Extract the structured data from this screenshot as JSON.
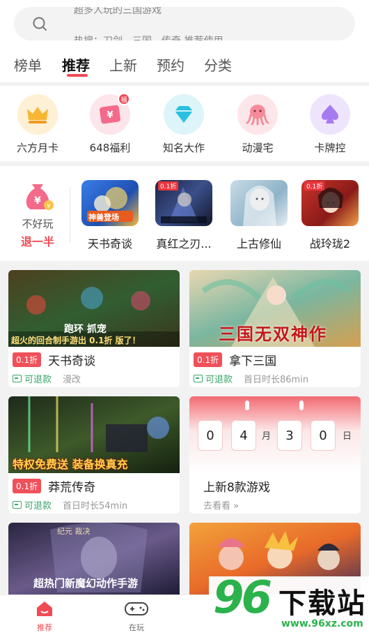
{
  "search": {
    "line1": "超多人玩的三国游戏",
    "line2": "热搜：刀剑、三国、传奇 推荐使用"
  },
  "tabs": [
    {
      "label": "榜单",
      "active": false
    },
    {
      "label": "推荐",
      "active": true
    },
    {
      "label": "上新",
      "active": false
    },
    {
      "label": "预约",
      "active": false
    },
    {
      "label": "分类",
      "active": false
    }
  ],
  "categories": [
    {
      "label": "六方月卡",
      "icon": "crown-icon",
      "color": "#f7b733"
    },
    {
      "label": "648福利",
      "icon": "ticket-icon",
      "color": "#f46a8a",
      "badge": "福"
    },
    {
      "label": "知名大作",
      "icon": "diamond-icon",
      "color": "#29c0e0"
    },
    {
      "label": "动漫宅",
      "icon": "octopus-icon",
      "color": "#f58a9a"
    },
    {
      "label": "卡牌控",
      "icon": "spade-icon",
      "color": "#a77bf0"
    }
  ],
  "refund_promo": {
    "line1": "不好玩",
    "line2": "退一半"
  },
  "featured_games": [
    {
      "name": "天书奇谈",
      "img_label": "神兽登场",
      "bg": "#2c6bd8"
    },
    {
      "name": "真红之刃...",
      "img_label": "0.1折",
      "bg": "#1f2a4a"
    },
    {
      "name": "上古修仙",
      "img_label": "",
      "bg": "#a7c6d8"
    },
    {
      "name": "战玲珑2",
      "img_label": "0.1折",
      "bg": "#c8352a"
    }
  ],
  "cards": [
    {
      "discount": "0.1折",
      "title": "天书奇谈",
      "refundable": "可退款",
      "meta": "漫改",
      "banner": "超火的回合制手游出 0.1折 版了！",
      "banner2": "跑环  抓宠"
    },
    {
      "discount": "0.1折",
      "title": "拿下三国",
      "refundable": "可退款",
      "meta": "首日时长86min",
      "banner": "三国无双神作"
    },
    {
      "discount": "0.1折",
      "title": "莽荒传奇",
      "refundable": "可退款",
      "meta": "首日时长54min",
      "banner": "特权免费送 装备换真充"
    },
    {
      "title": "上新8款游戏",
      "more": "去看看 »",
      "countdown": {
        "d1": "0",
        "d2": "4",
        "unit1": "月",
        "d3": "3",
        "d4": "0",
        "unit2": "日"
      }
    },
    {
      "banner": "超热门新魔幻动作手游",
      "banner_top": "纪元  裁决"
    },
    {
      "banner": ""
    }
  ],
  "bottom_nav": [
    {
      "label": "推荐",
      "active": true
    },
    {
      "label": "在玩",
      "active": false
    }
  ],
  "watermark": {
    "number": "96",
    "text": "下载站",
    "url": "www.96xz.com"
  },
  "colors": {
    "accent": "#f04b55",
    "green": "#3aa66b"
  }
}
